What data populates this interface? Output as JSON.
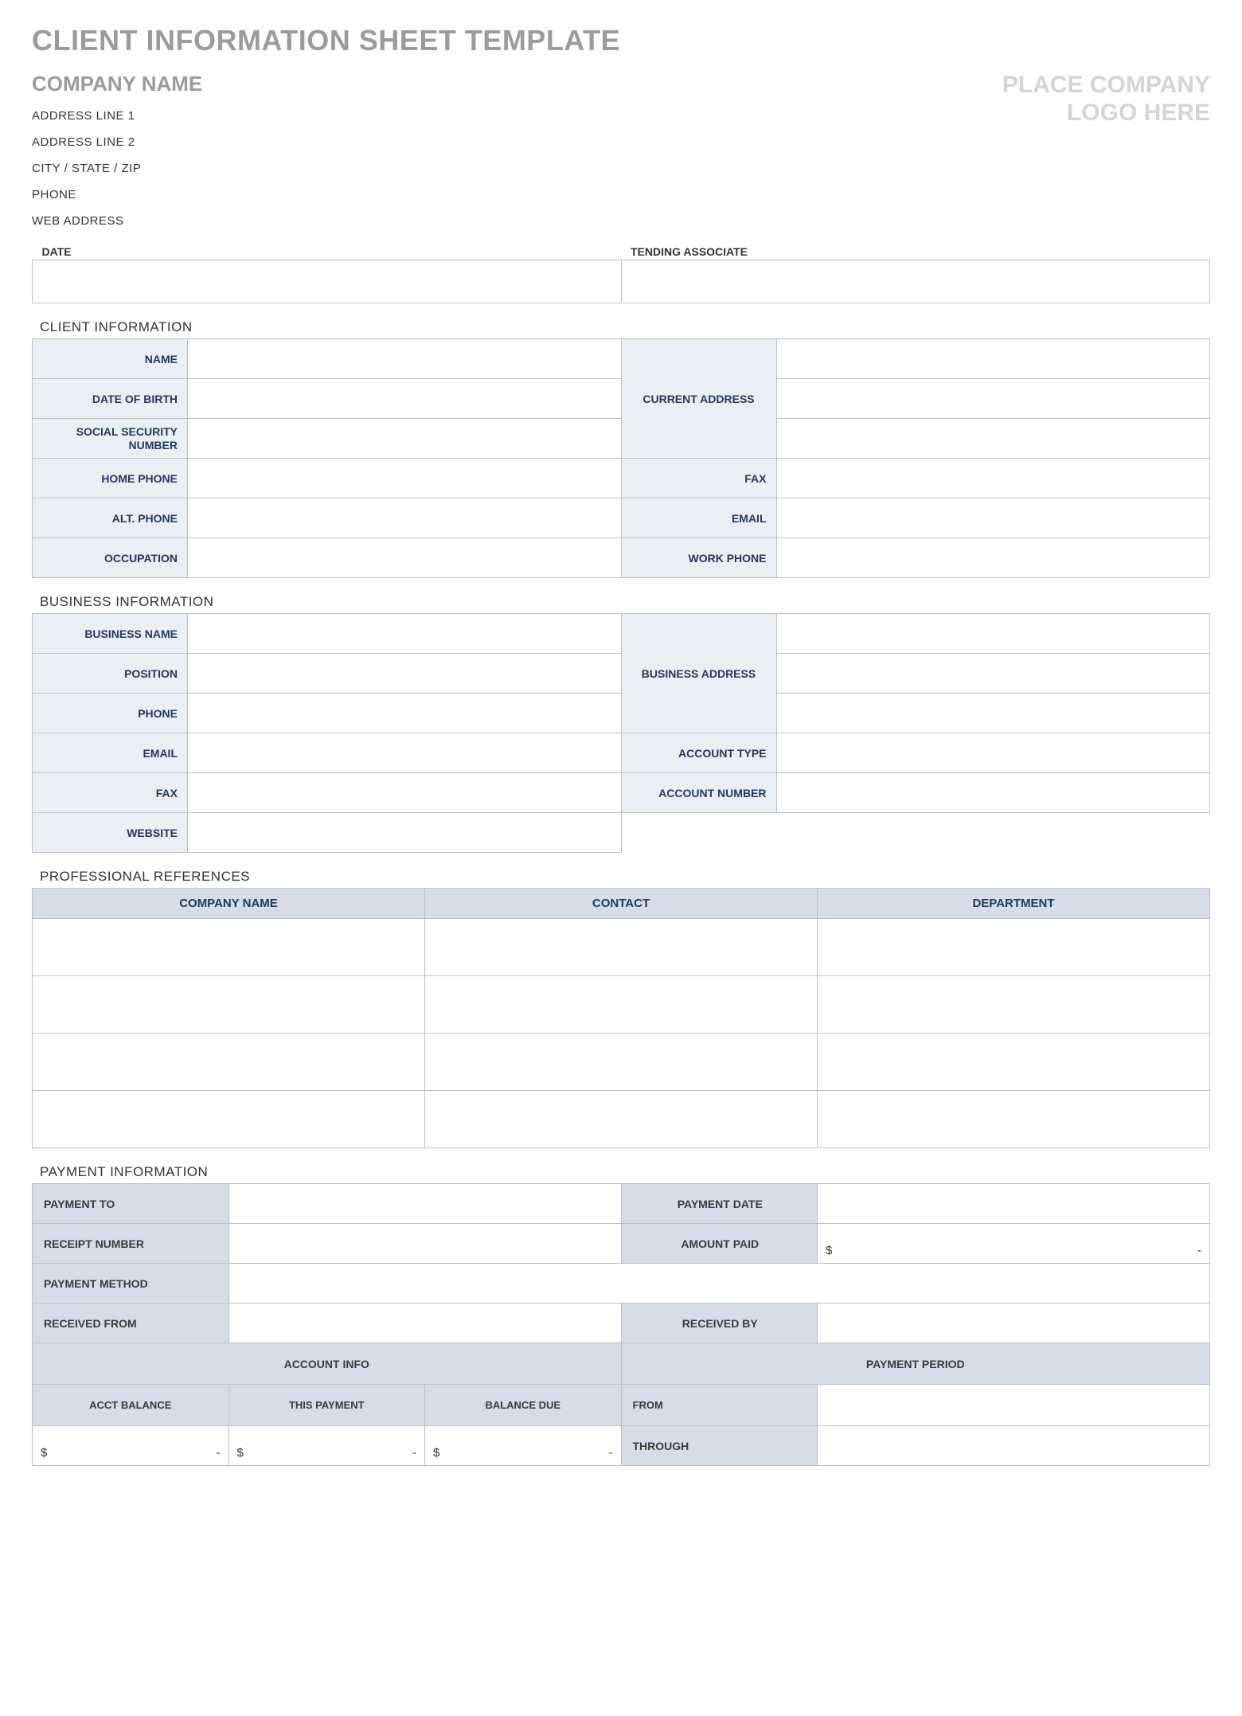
{
  "title": "CLIENT INFORMATION SHEET TEMPLATE",
  "company": {
    "name": "COMPANY NAME",
    "address_line_1": "ADDRESS LINE 1",
    "address_line_2": "ADDRESS LINE 2",
    "city_state_zip": "CITY / STATE / ZIP",
    "phone": "PHONE",
    "web": "WEB ADDRESS"
  },
  "logo_text_line1": "PLACE COMPANY",
  "logo_text_line2": "LOGO HERE",
  "header_fields": {
    "date_label": "DATE",
    "assoc_label": "TENDING ASSOCIATE"
  },
  "sections": {
    "client_info": "CLIENT INFORMATION",
    "business_info": "BUSINESS INFORMATION",
    "prof_refs": "PROFESSIONAL REFERENCES",
    "payment_info": "PAYMENT INFORMATION"
  },
  "client": {
    "name": "NAME",
    "dob": "DATE OF BIRTH",
    "ssn1": "SOCIAL SECURITY",
    "ssn2": "NUMBER",
    "current_address": "CURRENT ADDRESS",
    "home_phone": "HOME PHONE",
    "fax": "FAX",
    "alt_phone": "ALT. PHONE",
    "email": "EMAIL",
    "occupation": "OCCUPATION",
    "work_phone": "WORK PHONE"
  },
  "business": {
    "business_name": "BUSINESS NAME",
    "position": "POSITION",
    "phone": "PHONE",
    "business_address": "BUSINESS ADDRESS",
    "email": "EMAIL",
    "account_type": "ACCOUNT TYPE",
    "fax": "FAX",
    "account_number": "ACCOUNT NUMBER",
    "website": "WEBSITE"
  },
  "refs": {
    "company": "COMPANY NAME",
    "contact": "CONTACT",
    "department": "DEPARTMENT"
  },
  "payment": {
    "payment_to": "PAYMENT TO",
    "payment_date": "PAYMENT DATE",
    "receipt_number": "RECEIPT NUMBER",
    "amount_paid": "AMOUNT PAID",
    "payment_method": "PAYMENT METHOD",
    "received_from": "RECEIVED FROM",
    "received_by": "RECEIVED BY",
    "account_info": "ACCOUNT INFO",
    "payment_period": "PAYMENT PERIOD",
    "acct_balance": "ACCT BALANCE",
    "this_payment": "THIS PAYMENT",
    "balance_due": "BALANCE DUE",
    "from": "FROM",
    "through": "THROUGH",
    "amount_paid_value_sym": "$",
    "amount_paid_value_dash": "-"
  },
  "money_sym": "$",
  "money_dash": "-"
}
